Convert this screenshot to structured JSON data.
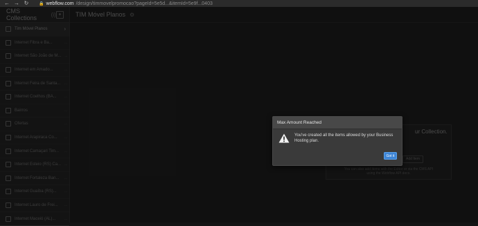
{
  "browser": {
    "nav": [
      "←",
      "→",
      "↻"
    ],
    "url_host": "webflow.com",
    "url_path": "/design/timmovelpromocao?pageId=5e5d...&itemId=5e9f...0403"
  },
  "sidebar": {
    "title": "CMS Collections",
    "count": "(i)",
    "add_label": "+",
    "items": [
      {
        "label": "Tim Móvel Planos",
        "meta": "",
        "active": true
      },
      {
        "label": "Internet Fibra e Ba...",
        "meta": "..."
      },
      {
        "label": "Internet São João de M...",
        "meta": "..."
      },
      {
        "label": "Internet em Amado...",
        "meta": "..."
      },
      {
        "label": "Internet Feira de Santa...",
        "meta": "..."
      },
      {
        "label": "Internet Coelhos (BA...",
        "meta": "..."
      },
      {
        "label": "Bairros",
        "meta": "..."
      },
      {
        "label": "Ofertas",
        "meta": "..."
      },
      {
        "label": "Internet Arapiraca Co...",
        "meta": "..."
      },
      {
        "label": "Internet Camaçari Tim...",
        "meta": "..."
      },
      {
        "label": "Internet Esteio (RS) Ca...",
        "meta": "..."
      },
      {
        "label": "Internet Fortaleza Ban...",
        "meta": "..."
      },
      {
        "label": "Internet Guaíba (RS)...",
        "meta": "..."
      },
      {
        "label": "Internet Lauro de Frei...",
        "meta": "..."
      },
      {
        "label": "Internet Maceió (AL)...",
        "meta": "..."
      }
    ]
  },
  "topbar": {
    "collection_name": "TIM Móvel Planos",
    "settings_icon": "gear-icon"
  },
  "empty_state": {
    "title": "ur Collection.",
    "button": "Add Item",
    "help": "You can also add items with the Editor or via the CMS API using the Webflow API docs."
  },
  "modal": {
    "title": "Max Amount Reached",
    "message": "You've created all the items allowed by your Business Hosting plan.",
    "button": "Got it",
    "icon": "warning-icon",
    "accent": "#3d85d6"
  }
}
